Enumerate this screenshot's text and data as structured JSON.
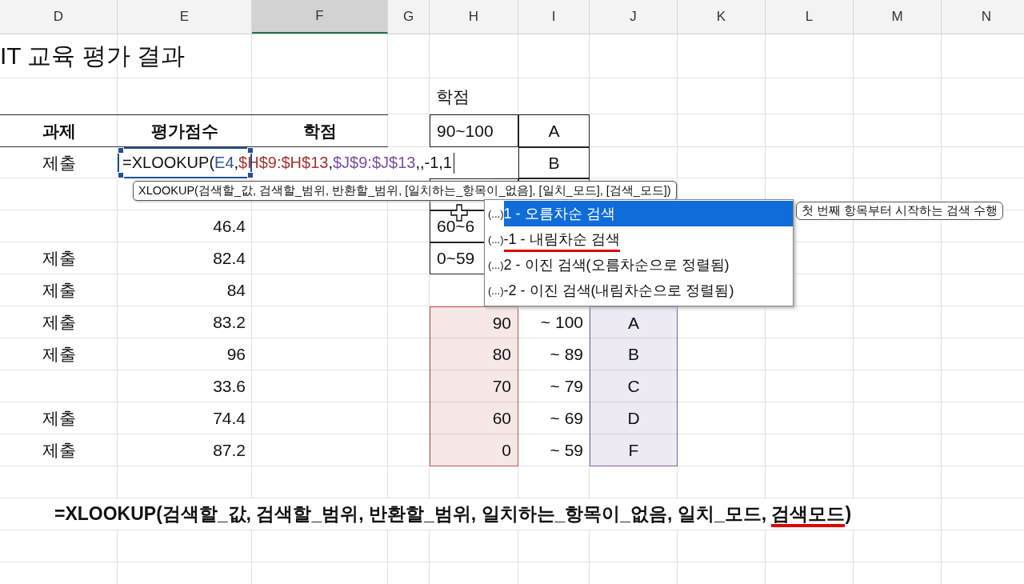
{
  "column_headers": [
    {
      "label": "D",
      "selected": false
    },
    {
      "label": "E",
      "selected": false
    },
    {
      "label": "F",
      "selected": true
    },
    {
      "label": "G",
      "selected": false
    },
    {
      "label": "H",
      "selected": false
    },
    {
      "label": "I",
      "selected": false
    },
    {
      "label": "J",
      "selected": false
    },
    {
      "label": "K",
      "selected": false
    },
    {
      "label": "L",
      "selected": false
    },
    {
      "label": "M",
      "selected": false
    },
    {
      "label": "N",
      "selected": false
    }
  ],
  "rows": [
    {
      "cells": [
        {
          "text": "IT 교육 평가 결과",
          "kind": "title"
        }
      ]
    },
    {
      "cells": [
        null,
        null,
        null,
        null,
        {
          "text": "학점",
          "kind": "left"
        }
      ]
    },
    {
      "cells": [
        {
          "text": "과제",
          "kind": "header"
        },
        {
          "text": "평가점수",
          "kind": "header"
        },
        {
          "text": "학점",
          "kind": "header"
        },
        null,
        {
          "text": "90~100",
          "kind": "boxed_left"
        },
        {
          "text": "A",
          "kind": "boxed_center"
        }
      ]
    },
    {
      "cells": [
        {
          "text": "제출",
          "kind": "center"
        },
        {
          "kind": "input",
          "parts": [
            {
              "text": "=XLOOKUP(",
              "color": "#111111"
            },
            {
              "text": "E4",
              "color": "#2f5597"
            },
            {
              "text": ",",
              "color": "#111111"
            },
            {
              "text": "$H$9:$H$13",
              "color": "#a5342f"
            },
            {
              "text": ",",
              "color": "#111111"
            },
            {
              "text": "$J$9:$J$13",
              "color": "#7a4fa0"
            },
            {
              "text": ",,-1,1",
              "color": "#111111"
            }
          ]
        },
        null,
        null,
        null,
        {
          "text": "B",
          "kind": "boxed_center"
        }
      ]
    },
    {
      "cells": [
        null,
        null,
        null,
        null,
        {
          "kind": "boxed_left"
        },
        {
          "kind": "boxed_center"
        }
      ]
    },
    {
      "cells": [
        null,
        {
          "text": "46.4",
          "kind": "right"
        },
        null,
        null,
        {
          "text": "60~6",
          "kind": "boxed_left"
        }
      ]
    },
    {
      "cells": [
        {
          "text": "제출",
          "kind": "center"
        },
        {
          "text": "82.4",
          "kind": "right"
        },
        null,
        null,
        {
          "text": "0~59",
          "kind": "boxed_left"
        }
      ]
    },
    {
      "cells": [
        {
          "text": "제출",
          "kind": "center"
        },
        {
          "text": "84",
          "kind": "right"
        }
      ]
    },
    {
      "cells": [
        {
          "text": "제출",
          "kind": "center"
        },
        {
          "text": "83.2",
          "kind": "right"
        },
        null,
        null,
        {
          "text": "90",
          "kind": "right",
          "color": "#c0504d"
        },
        {
          "text": "~ 100",
          "kind": "right"
        },
        {
          "text": "A",
          "kind": "center",
          "color": "#7b5ea7"
        }
      ]
    },
    {
      "cells": [
        {
          "text": "제출",
          "kind": "center"
        },
        {
          "text": "96",
          "kind": "right"
        },
        null,
        null,
        {
          "text": "80",
          "kind": "right",
          "color": "#c0504d"
        },
        {
          "text": "~ 89",
          "kind": "right"
        },
        {
          "text": "B",
          "kind": "center",
          "color": "#7b5ea7"
        }
      ]
    },
    {
      "cells": [
        null,
        {
          "text": "33.6",
          "kind": "right"
        },
        null,
        null,
        {
          "text": "70",
          "kind": "right",
          "color": "#c0504d"
        },
        {
          "text": "~ 79",
          "kind": "right"
        },
        {
          "text": "C",
          "kind": "center",
          "color": "#7b5ea7"
        }
      ]
    },
    {
      "cells": [
        {
          "text": "제출",
          "kind": "center"
        },
        {
          "text": "74.4",
          "kind": "right"
        },
        null,
        null,
        {
          "text": "60",
          "kind": "right",
          "color": "#c0504d"
        },
        {
          "text": "~ 69",
          "kind": "right"
        },
        {
          "text": "D",
          "kind": "center",
          "color": "#7b5ea7"
        }
      ]
    },
    {
      "cells": [
        {
          "text": "제출",
          "kind": "center"
        },
        {
          "text": "87.2",
          "kind": "right"
        },
        null,
        null,
        {
          "text": "0",
          "kind": "right",
          "color": "#c0504d"
        },
        {
          "text": "~ 59",
          "kind": "right"
        },
        {
          "text": "F",
          "kind": "center",
          "color": "#7b5ea7"
        }
      ]
    }
  ],
  "tooltip": "XLOOKUP(검색할_값, 검색할_범위, 반환할_범위, [일치하는_항목이_없음], [일치_모드], [검색_모드])",
  "autocomplete": [
    {
      "prefix": "(...)",
      "label": "1 - 오름차순 검색",
      "selected": true,
      "underlined": false
    },
    {
      "prefix": "(...)",
      "label": "-1 - 내림차순 검색",
      "selected": false,
      "underlined": true
    },
    {
      "prefix": "(...)",
      "label": "2 - 이진 검색(오름차순으로 정렬됨)",
      "selected": false,
      "underlined": false
    },
    {
      "prefix": "(...)",
      "label": "-2 - 이진 검색(내림차순으로 정렬됨)",
      "selected": false,
      "underlined": false
    }
  ],
  "side_tip": "첫 번째 항목부터 시작하는 검색 수행",
  "caption": [
    {
      "text": "=XLOOKUP(검색할_값, 검색할_범위, 반환할_범위, 일치하는_항목이_없음, 일치_모드, ",
      "underlined": false
    },
    {
      "text": "검색모드",
      "underlined": true
    },
    {
      "text": ")",
      "underlined": false
    }
  ]
}
